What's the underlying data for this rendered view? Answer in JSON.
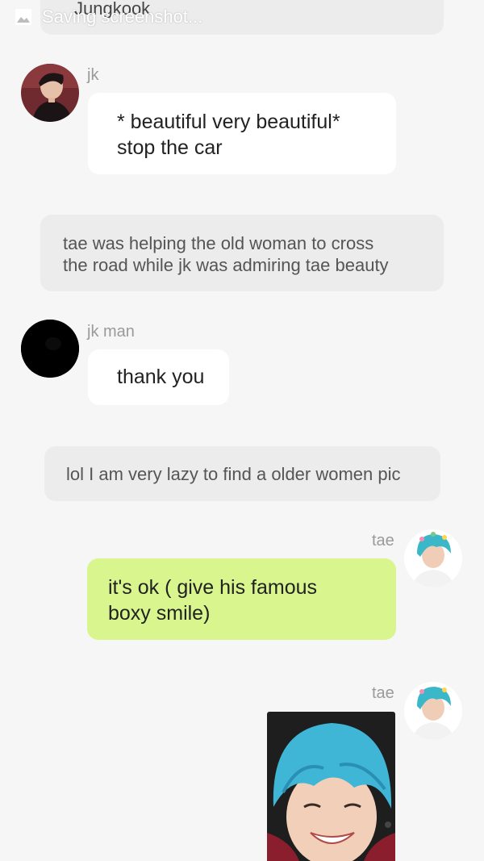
{
  "status_bar": {
    "notice": "Saving screenshot..."
  },
  "messages": {
    "top_cut": "Jungkook",
    "m1": {
      "sender": "jk",
      "lines": [
        "* beautiful very beautiful*",
        "stop the car"
      ]
    },
    "n1": {
      "lines": [
        "tae was helping the old woman to cross",
        "the road while jk was admiring tae beauty"
      ]
    },
    "m2": {
      "sender": "jk man",
      "text": "thank you"
    },
    "n2": {
      "text": "lol I am very lazy to find a older women pic"
    },
    "m3": {
      "sender": "tae",
      "lines": [
        "it's ok ( give his famous",
        "boxy smile)"
      ]
    },
    "m4": {
      "sender": "tae"
    }
  },
  "colors": {
    "background": "#f6f6f6",
    "incoming_bubble": "#ffffff",
    "outgoing_bubble": "#d9f58e",
    "narration_bubble": "#ececec"
  }
}
